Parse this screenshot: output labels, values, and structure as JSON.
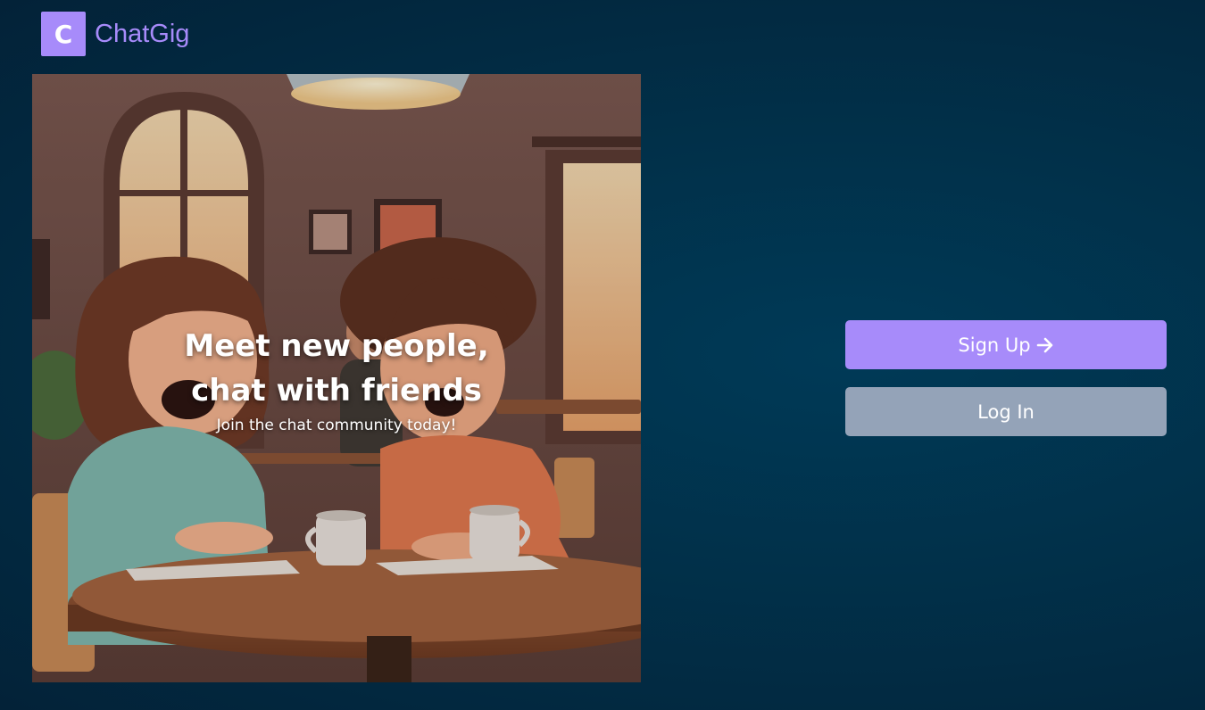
{
  "app": {
    "logo_letter": "C",
    "name": "ChatGig",
    "accent_color": "#a78bfa"
  },
  "hero": {
    "title_line1": "Meet new people,",
    "title_line2": "chat with friends",
    "subtitle": "Join the chat community today!",
    "image_description_icon": "cafe-illustration"
  },
  "actions": {
    "signup_label": "Sign Up",
    "signup_icon": "arrow-right-icon",
    "login_label": "Log In",
    "login_color": "#94a3b8"
  }
}
